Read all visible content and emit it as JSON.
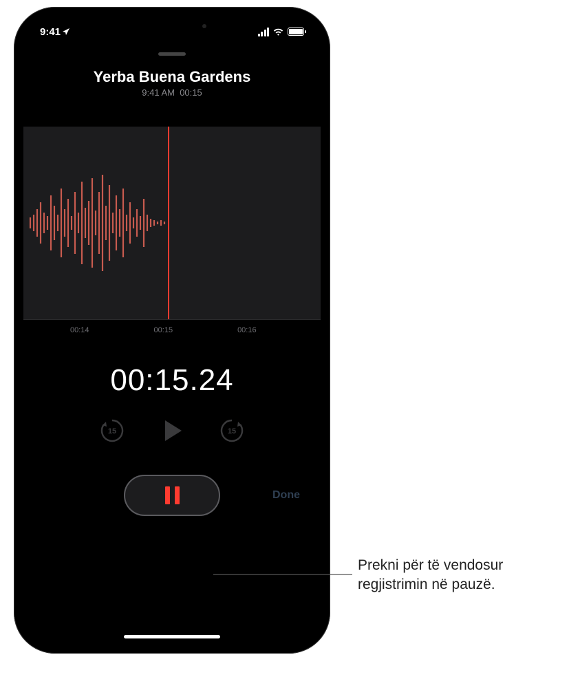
{
  "status": {
    "time": "9:41",
    "location_arrow": "◤"
  },
  "recording": {
    "title": "Yerba Buena Gardens",
    "time": "9:41 AM",
    "duration": "00:15"
  },
  "timeline": {
    "ticks": [
      "00:14",
      "00:15",
      "00:16"
    ]
  },
  "timer": "00:15.24",
  "skip_back_label": "15",
  "skip_fwd_label": "15",
  "done_label": "Done",
  "callout": {
    "line1": "Prekni për të vendosur",
    "line2": "regjistrimin në pauzë."
  }
}
